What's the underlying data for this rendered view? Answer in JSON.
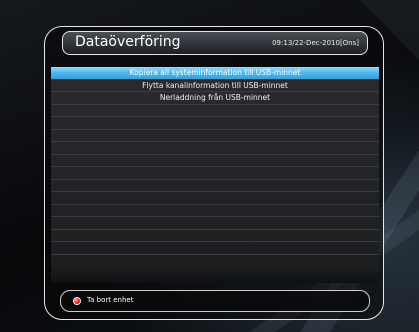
{
  "header": {
    "title": "Dataöverföring",
    "datetime": "09:13/22-Dec-2010[Ons]"
  },
  "menu": {
    "items": [
      {
        "label": "Kopiera all systeminformation till USB-minnet",
        "selected": true
      },
      {
        "label": "Flytta kanalinformation till USB-minnet",
        "selected": false
      },
      {
        "label": "Nerladdning från USB-minnet",
        "selected": false
      },
      {
        "label": "",
        "selected": false
      },
      {
        "label": "",
        "selected": false
      },
      {
        "label": "",
        "selected": false
      },
      {
        "label": "",
        "selected": false
      },
      {
        "label": "",
        "selected": false
      },
      {
        "label": "",
        "selected": false
      },
      {
        "label": "",
        "selected": false
      },
      {
        "label": "",
        "selected": false
      },
      {
        "label": "",
        "selected": false
      },
      {
        "label": "",
        "selected": false
      },
      {
        "label": "",
        "selected": false
      },
      {
        "label": "",
        "selected": false
      },
      {
        "label": "",
        "selected": false
      }
    ]
  },
  "help": {
    "button_color": "red",
    "label": "Ta bort enhet"
  },
  "colors": {
    "highlight": "#4fb6ea",
    "frame": "#e6e6e6",
    "background": "#0a0c10"
  }
}
